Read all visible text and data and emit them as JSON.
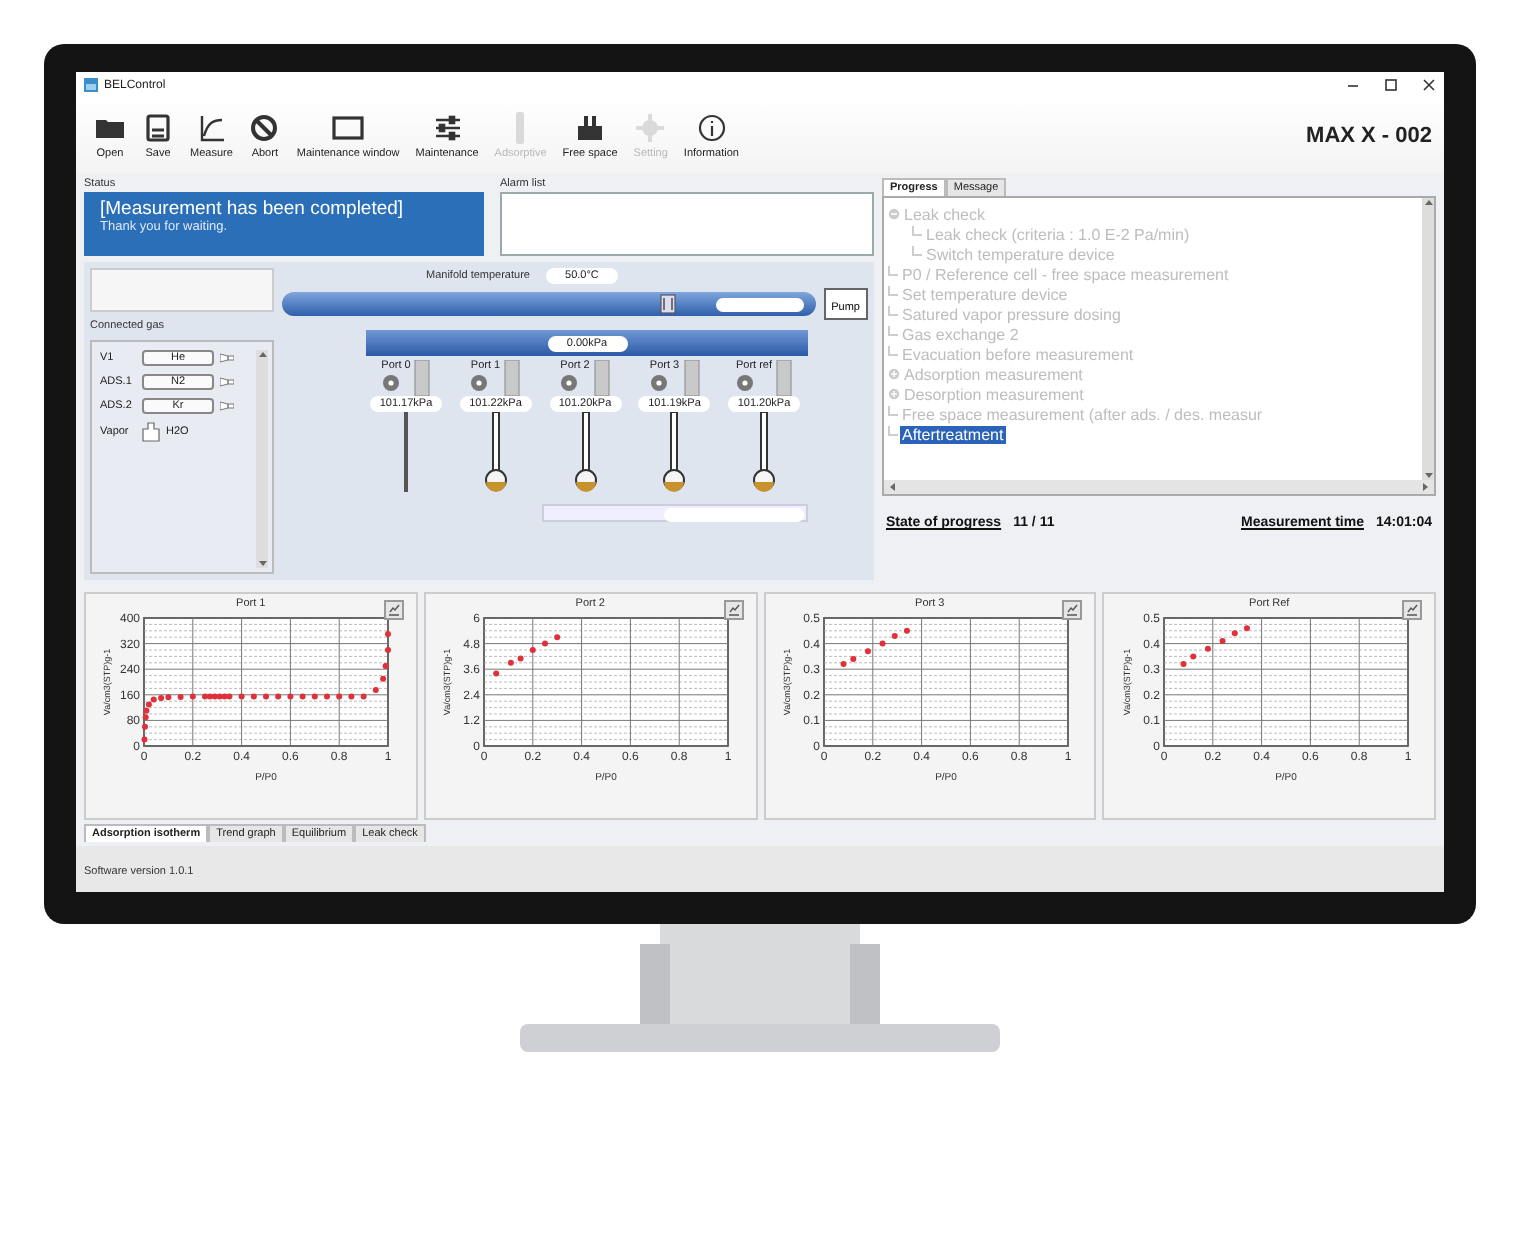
{
  "window": {
    "title": "BELControl",
    "instrument": "MAX X - 002"
  },
  "toolbar": [
    {
      "label": "Open",
      "disabled": false
    },
    {
      "label": "Save",
      "disabled": false
    },
    {
      "label": "Measure",
      "disabled": false
    },
    {
      "label": "Abort",
      "disabled": false
    },
    {
      "label": "Maintenance window",
      "disabled": false
    },
    {
      "label": "Maintenance",
      "disabled": false
    },
    {
      "label": "Adsorptive",
      "disabled": true
    },
    {
      "label": "Free space",
      "disabled": false
    },
    {
      "label": "Setting",
      "disabled": true
    },
    {
      "label": "Information",
      "disabled": false
    }
  ],
  "status": {
    "label": "Status",
    "title": "[Measurement has been completed]",
    "message": "Thank you for waiting."
  },
  "alarm_list": {
    "label": "Alarm list"
  },
  "manifold": {
    "temperature_label": "Manifold temperature",
    "temperature": "50.0°C",
    "pressure": "0.00kPa",
    "pump": "Pump"
  },
  "connected_gas": {
    "label": "Connected gas",
    "items": [
      {
        "port": "V1",
        "gas": "He",
        "kind": "cylinder"
      },
      {
        "port": "ADS.1",
        "gas": "N2",
        "kind": "cylinder"
      },
      {
        "port": "ADS.2",
        "gas": "Kr",
        "kind": "cylinder"
      },
      {
        "port": "Vapor",
        "gas": "H2O",
        "kind": "vial"
      }
    ]
  },
  "ports": [
    {
      "name": "Port 0",
      "pressure": "101.17kPa",
      "kind": "rod"
    },
    {
      "name": "Port 1",
      "pressure": "101.22kPa",
      "kind": "cell"
    },
    {
      "name": "Port 2",
      "pressure": "101.20kPa",
      "kind": "cell"
    },
    {
      "name": "Port 3",
      "pressure": "101.19kPa",
      "kind": "cell"
    },
    {
      "name": "Port ref",
      "pressure": "101.20kPa",
      "kind": "cell"
    }
  ],
  "progress_tabs": [
    {
      "label": "Progress",
      "selected": true
    },
    {
      "label": "Message",
      "selected": false
    }
  ],
  "progress_tree": [
    {
      "label": "Leak check",
      "expanded": true,
      "selected": false,
      "children": [
        {
          "label": "Leak check (criteria : 1.0 E-2 Pa/min)",
          "selected": false
        },
        {
          "label": "Switch temperature device",
          "selected": false
        }
      ]
    },
    {
      "label": "P0 / Reference cell - free space measurement",
      "selected": false
    },
    {
      "label": "Set temperature device",
      "selected": false
    },
    {
      "label": "Satured vapor pressure dosing",
      "selected": false
    },
    {
      "label": "Gas exchange 2",
      "selected": false
    },
    {
      "label": "Evacuation before measurement",
      "selected": false
    },
    {
      "label": "Adsorption measurement",
      "expanded": false,
      "selected": false
    },
    {
      "label": "Desorption measurement",
      "expanded": false,
      "selected": false
    },
    {
      "label": "Free space measurement (after ads. / des. measur",
      "selected": false
    },
    {
      "label": "Aftertreatment",
      "selected": true
    }
  ],
  "progress_footer": {
    "state_label": "State of progress",
    "state": "11 / 11",
    "time_label": "Measurement time",
    "time": "14:01:04"
  },
  "charts": [
    {
      "chart_data": {
        "type": "scatter",
        "title": "Port 1",
        "xlabel": "P/P0",
        "ylabel": "Va/cm3(STP)g-1",
        "x": [
          0.002,
          0.004,
          0.007,
          0.01,
          0.02,
          0.04,
          0.07,
          0.1,
          0.15,
          0.2,
          0.25,
          0.27,
          0.29,
          0.31,
          0.33,
          0.35,
          0.4,
          0.45,
          0.5,
          0.55,
          0.6,
          0.65,
          0.7,
          0.75,
          0.8,
          0.85,
          0.9,
          0.95,
          0.98,
          0.99,
          1.0,
          1.0
        ],
        "series": [
          {
            "color": "#e0303a",
            "values": [
              20,
              60,
              90,
              110,
              130,
              145,
              150,
              152,
              153,
              155,
              155,
              155,
              155,
              155,
              155,
              155,
              155,
              155,
              155,
              155,
              155,
              155,
              155,
              155,
              155,
              155,
              155,
              175,
              210,
              250,
              300,
              350
            ]
          }
        ],
        "xlim": [
          0,
          1
        ],
        "ylim": [
          0,
          400
        ],
        "xticks": [
          0,
          0.2,
          0.4,
          0.6,
          0.8,
          1
        ],
        "yticks": [
          0,
          80,
          160,
          240,
          320,
          400
        ],
        "grid": true
      }
    },
    {
      "chart_data": {
        "type": "scatter",
        "title": "Port 2",
        "xlabel": "P/P0",
        "ylabel": "Va/cm3(STP)g-1",
        "x": [
          0.05,
          0.11,
          0.15,
          0.2,
          0.25,
          0.3
        ],
        "series": [
          {
            "color": "#e0303a",
            "values": [
              3.4,
              3.9,
              4.1,
              4.5,
              4.8,
              5.1
            ]
          }
        ],
        "xlim": [
          0,
          1
        ],
        "ylim": [
          0,
          6
        ],
        "xticks": [
          0,
          0.2,
          0.4,
          0.6,
          0.8,
          1
        ],
        "yticks": [
          0,
          1.2,
          2.4,
          3.6,
          4.8,
          6
        ],
        "grid": true
      }
    },
    {
      "chart_data": {
        "type": "scatter",
        "title": "Port 3",
        "xlabel": "P/P0",
        "ylabel": "Va/cm3(STP)g-1",
        "x": [
          0.08,
          0.12,
          0.18,
          0.24,
          0.29,
          0.34
        ],
        "series": [
          {
            "color": "#e0303a",
            "values": [
              0.32,
              0.34,
              0.37,
              0.4,
              0.43,
              0.45
            ]
          }
        ],
        "xlim": [
          0,
          1
        ],
        "ylim": [
          0,
          0.5
        ],
        "xticks": [
          0,
          0.2,
          0.4,
          0.6,
          0.8,
          1
        ],
        "yticks": [
          0,
          0.1,
          0.2,
          0.3,
          0.4,
          0.5
        ],
        "grid": true
      }
    },
    {
      "chart_data": {
        "type": "scatter",
        "title": "Port Ref",
        "xlabel": "P/P0",
        "ylabel": "Va/cm3(STP)g-1",
        "x": [
          0.08,
          0.12,
          0.18,
          0.24,
          0.29,
          0.34
        ],
        "series": [
          {
            "color": "#e0303a",
            "values": [
              0.32,
              0.35,
              0.38,
              0.41,
              0.44,
              0.46
            ]
          }
        ],
        "xlim": [
          0,
          1
        ],
        "ylim": [
          0,
          0.5
        ],
        "xticks": [
          0,
          0.2,
          0.4,
          0.6,
          0.8,
          1
        ],
        "yticks": [
          0,
          0.1,
          0.2,
          0.3,
          0.4,
          0.5
        ],
        "grid": true
      }
    }
  ],
  "chart_tabs": [
    {
      "label": "Adsorption isotherm",
      "selected": true
    },
    {
      "label": "Trend graph",
      "selected": false
    },
    {
      "label": "Equilibrium",
      "selected": false
    },
    {
      "label": "Leak check",
      "selected": false
    }
  ],
  "status_bar": {
    "text": "Software version 1.0.1"
  }
}
